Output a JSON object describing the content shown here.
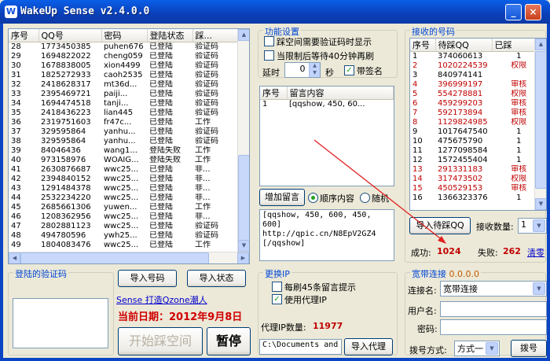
{
  "window": {
    "title": "WakeUp Sense v2.4.0.0",
    "app_icon": "W",
    "min": "_",
    "max": "□",
    "close": "×"
  },
  "account_list": {
    "columns": [
      "序号",
      "QQ号",
      "密码",
      "登陆状态",
      "踩..."
    ],
    "rows": [
      [
        "28",
        "1773450385",
        "puhen676",
        "已登陆",
        "验证码"
      ],
      [
        "29",
        "1694822022",
        "cheng059",
        "已登陆",
        "验证码"
      ],
      [
        "30",
        "1678838005",
        "xion4499",
        "已登陆",
        "验证码"
      ],
      [
        "31",
        "1825272933",
        "caoh2535",
        "已登陆",
        "验证码"
      ],
      [
        "32",
        "2418628317",
        "mt36d...",
        "已登陆",
        "验证码"
      ],
      [
        "33",
        "2395469721",
        "paiji...",
        "已登陆",
        "验证码"
      ],
      [
        "34",
        "1694474518",
        "tanji...",
        "已登陆",
        "验证码"
      ],
      [
        "35",
        "2418436223",
        "lian445",
        "已登陆",
        "验证码"
      ],
      [
        "36",
        "2319751603",
        "fr47c...",
        "已登陆",
        "工作"
      ],
      [
        "37",
        "329595864",
        "yanhu...",
        "已登陆",
        "验证码"
      ],
      [
        "38",
        "329595864",
        "yanhu...",
        "已登陆",
        "验证码"
      ],
      [
        "39",
        "84046436",
        "wang1...",
        "登陆失败",
        "工作"
      ],
      [
        "40",
        "973158976",
        "WOAIG...",
        "登陆失败",
        "工作"
      ],
      [
        "41",
        "2630876687",
        "wwc25...",
        "已登陆",
        "非..."
      ],
      [
        "42",
        "2394840152",
        "wwc25...",
        "已登陆",
        "非..."
      ],
      [
        "43",
        "1291484378",
        "wwc25...",
        "已登陆",
        "非..."
      ],
      [
        "44",
        "2532234220",
        "wwc25...",
        "已登陆",
        "非..."
      ],
      [
        "45",
        "2685661306",
        "yuwen...",
        "已登陆",
        "工作"
      ],
      [
        "46",
        "1208362956",
        "wwc25...",
        "已登陆",
        "非..."
      ],
      [
        "47",
        "2802881123",
        "wwc25...",
        "已登陆",
        "验证码"
      ],
      [
        "48",
        "494780596",
        "ywh25...",
        "已登陆",
        "验证码"
      ],
      [
        "49",
        "1804083476",
        "wwc25...",
        "已登陆",
        "工作"
      ]
    ]
  },
  "captcha": {
    "label": "登陆的验证码"
  },
  "buttons": {
    "import_accounts": "导入号码",
    "import_status": "导入状态",
    "start": "开始踩空间",
    "pause": "暂停",
    "add_message": "增加留言",
    "import_targets": "导入待踩QQ",
    "clear": "清零",
    "import_proxy": "导入代理",
    "dial": "拨号"
  },
  "link": {
    "text": "Sense 打造Qzone潮人"
  },
  "date": {
    "text": "当前日期：2012年9月8日"
  },
  "settings": {
    "title": "功能设置",
    "opt1": "踩空间需要验证码时显示",
    "opt2": "当限制后等待40分钟再刷",
    "delay_label": "延时",
    "delay_value": "0",
    "delay_unit": "秒",
    "sign_label": "带签名"
  },
  "messages": {
    "columns": [
      "序号",
      "留言内容"
    ],
    "rows": [
      [
        "1",
        "[qqshow, 450, 60..."
      ]
    ],
    "order_seq": "顺序内容",
    "order_rand": "随机",
    "content_lines": [
      "[qqshow, 450, 600, 450, 600]",
      "http://qpic.cn/N8EpV2GZ4",
      "[/qqshow]"
    ]
  },
  "ip": {
    "title": "更换IP",
    "opt1": "每刷45条留言提示",
    "opt2": "使用代理IP",
    "proxy_count_label": "代理IP数量:",
    "proxy_count": "11977",
    "proxy_path": "C:\\Documents and S"
  },
  "targets": {
    "title": "接收的号码",
    "columns": [
      "序号",
      "待踩QQ",
      "已踩"
    ],
    "rows": [
      [
        "1",
        "374060613",
        "1",
        "n"
      ],
      [
        "2",
        "1020224539",
        "权限",
        "r"
      ],
      [
        "3",
        "840974141",
        "",
        ""
      ],
      [
        "4",
        "396999197",
        "审核",
        "r"
      ],
      [
        "5",
        "554278881",
        "权限",
        "r"
      ],
      [
        "6",
        "459299203",
        "审核",
        "r"
      ],
      [
        "7",
        "592173894",
        "审核",
        "r"
      ],
      [
        "8",
        "1129824985",
        "权限",
        "r"
      ],
      [
        "9",
        "1017647540",
        "1",
        "n"
      ],
      [
        "10",
        "475675790",
        "1",
        "n"
      ],
      [
        "11",
        "1277098584",
        "1",
        "n"
      ],
      [
        "12",
        "1572455404",
        "1",
        "n"
      ],
      [
        "13",
        "291331183",
        "审核",
        "r"
      ],
      [
        "14",
        "317473502",
        "权限",
        "r"
      ],
      [
        "15",
        "450529153",
        "审核",
        "r"
      ],
      [
        "16",
        "1366323376",
        "1",
        "n"
      ]
    ],
    "count_label": "接收数量:",
    "count_value": "1",
    "success_label": "成功:",
    "success": "1024",
    "fail_label": "失败:",
    "fail": "262"
  },
  "broadband": {
    "title": "宽带连接",
    "ip": "0.0.0.0",
    "conn_label": "连接名:",
    "conn_value": "宽带连接",
    "user_label": "用户名:",
    "pass_label": "密码:",
    "dial_label": "拨号方式:",
    "dial_value": "方式一"
  },
  "colors": {
    "title_bar": "#0a4fd8",
    "success": "#c00000",
    "group_label": "#0046d5",
    "arrow": "#e02020"
  },
  "icons": {
    "app": "wakeup-app-icon",
    "dropdown": "chevron-down-icon"
  }
}
